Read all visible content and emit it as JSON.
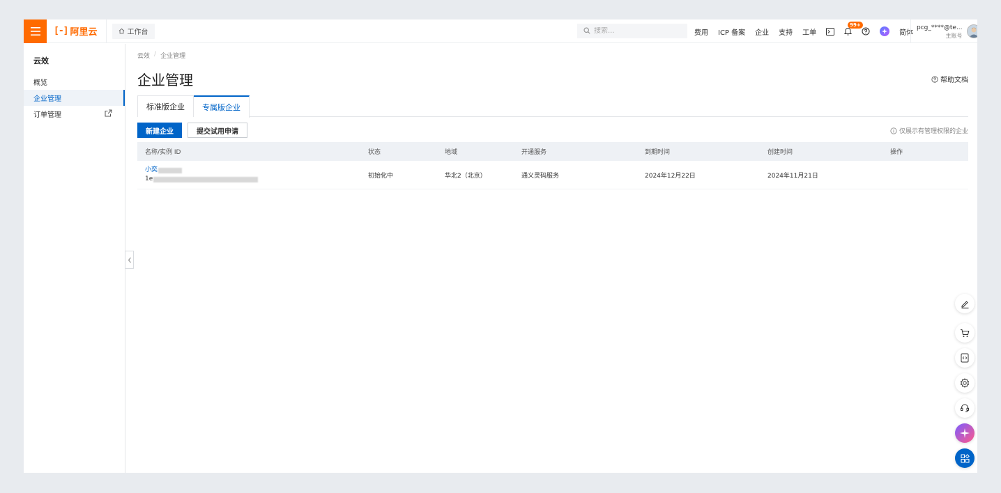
{
  "topbar": {
    "logo_mark": "[-]",
    "logo_text": "阿里云",
    "workbench_label": "工作台",
    "search_placeholder": "搜索...",
    "links": [
      "费用",
      "ICP 备案",
      "企业",
      "支持",
      "工单"
    ],
    "notification_badge": "99+",
    "language": "简体",
    "user_name": "pcg_****@te...",
    "user_role": "主账号"
  },
  "sidebar": {
    "title": "云效",
    "items": [
      {
        "label": "概览",
        "active": false
      },
      {
        "label": "企业管理",
        "active": true
      },
      {
        "label": "订单管理",
        "active": false,
        "external": true
      }
    ]
  },
  "main": {
    "breadcrumb": [
      "云效",
      "企业管理"
    ],
    "title": "企业管理",
    "help_label": "帮助文档",
    "tabs": [
      {
        "label": "标准版企业",
        "active": false
      },
      {
        "label": "专属版企业",
        "active": true
      }
    ],
    "buttons": {
      "create": "新建企业",
      "trial": "提交试用申请"
    },
    "note": "仅展示有管理权限的企业",
    "table": {
      "columns": [
        "名称/实例 ID",
        "状态",
        "地域",
        "开通服务",
        "到期时间",
        "创建时间",
        "操作"
      ],
      "rows": [
        {
          "name_prefix": "小奕",
          "id_prefix": "1e",
          "status": "初始化中",
          "region": "华北2（北京）",
          "service": "通义灵码服务",
          "expire": "2024年12月22日",
          "created": "2024年11月21日",
          "action": ""
        }
      ]
    }
  },
  "colors": {
    "brand_orange": "#ff6a00",
    "primary_blue": "#0064c8"
  },
  "float_tools": [
    "edit-icon",
    "cart-icon",
    "code-icon",
    "settings-icon",
    "headset-icon",
    "ai-assistant-icon",
    "apps-icon"
  ]
}
